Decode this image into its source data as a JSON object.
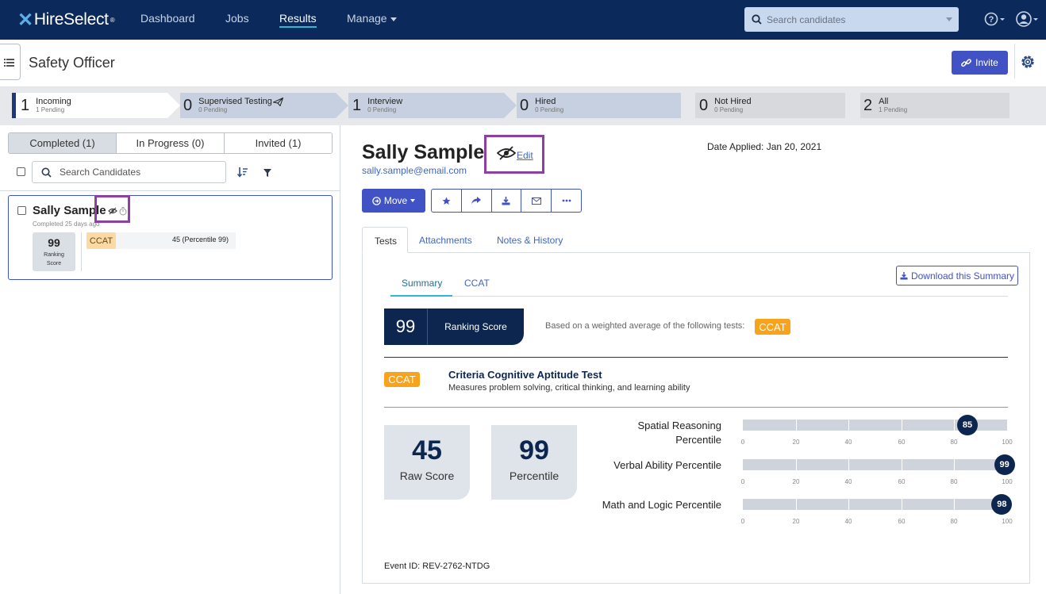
{
  "nav": {
    "logo_text": "HireSelect",
    "links": [
      "Dashboard",
      "Jobs",
      "Results",
      "Manage"
    ],
    "search_placeholder": "Search candidates"
  },
  "subheader": {
    "title": "Safety Officer",
    "invite_label": "Invite"
  },
  "pipeline": [
    {
      "count": "1",
      "label": "Incoming",
      "pending": "1 Pending"
    },
    {
      "count": "0",
      "label": "Supervised Testing",
      "pending": "0 Pending"
    },
    {
      "count": "1",
      "label": "Interview",
      "pending": "0 Pending"
    },
    {
      "count": "0",
      "label": "Hired",
      "pending": "0 Pending"
    },
    {
      "count": "0",
      "label": "Not Hired",
      "pending": "0 Pending"
    },
    {
      "count": "2",
      "label": "All",
      "pending": "1 Pending"
    }
  ],
  "left": {
    "tabs": [
      "Completed (1)",
      "In Progress (0)",
      "Invited (1)"
    ],
    "search_placeholder": "Search Candidates",
    "candidate": {
      "name": "Sally Sample",
      "completed": "Completed 25 days ago",
      "ranking_score": "99",
      "ranking_label_1": "Ranking",
      "ranking_label_2": "Score",
      "test": "CCAT",
      "test_result": "45 (Percentile 99)"
    }
  },
  "detail": {
    "name": "Sally Sample",
    "email": "sally.sample@email.com",
    "edit_label": "Edit",
    "date_applied": "Date Applied: Jan 20, 2021",
    "move_label": "Move",
    "tabs": [
      "Tests",
      "Attachments",
      "Notes & History"
    ],
    "download_label": "Download this Summary",
    "subtabs": [
      "Summary",
      "CCAT"
    ],
    "ranking_score": "99",
    "ranking_label": "Ranking Score",
    "based_on": "Based on a weighted average of the following tests:",
    "test_tag": "CCAT",
    "test_name": "Criteria Cognitive Aptitude Test",
    "test_desc": "Measures problem solving, critical thinking, and learning ability",
    "raw_score": "45",
    "raw_score_label": "Raw Score",
    "percentile": "99",
    "percentile_label": "Percentile",
    "bars": [
      {
        "label_1": "Spatial Reasoning",
        "label_2": "Percentile",
        "value": 85
      },
      {
        "label_1": "Verbal Ability Percentile",
        "label_2": "",
        "value": 99
      },
      {
        "label_1": "Math and Logic Percentile",
        "label_2": "",
        "value": 98
      }
    ],
    "axis_ticks": [
      "0",
      "20",
      "40",
      "60",
      "80",
      "100"
    ],
    "event_id": "Event ID: REV-2762-NTDG"
  },
  "colors": {
    "nav_bg": "#0b2a5b",
    "primary": "#4153c4",
    "navy": "#0d2650",
    "ccat": "#f9a31a",
    "highlight": "#8e3fa3"
  }
}
